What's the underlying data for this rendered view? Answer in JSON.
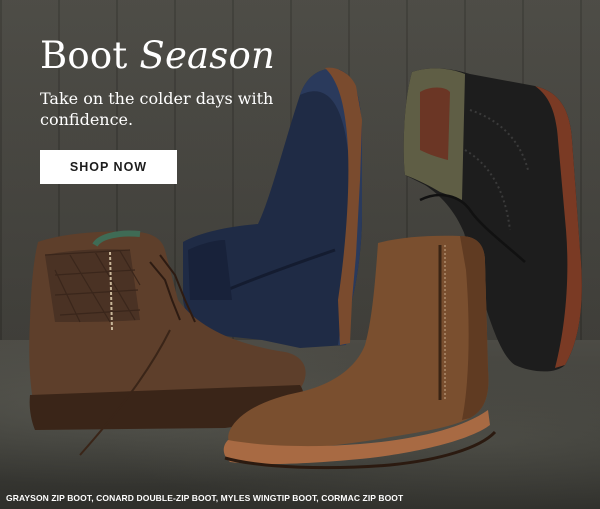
{
  "hero": {
    "title_main": "Boot",
    "title_italic": "Season",
    "subtitle": "Take on the colder days with confidence.",
    "cta_label": "SHOP NOW",
    "caption": "GRAYSON ZIP BOOT, CONARD DOUBLE-ZIP BOOT, MYLES WINGTIP BOOT, CORMAC ZIP BOOT"
  },
  "colors": {
    "background": "#3b3a35",
    "text": "#ffffff",
    "button_bg": "#ffffff",
    "button_text": "#1c1c1c"
  },
  "products": [
    {
      "name": "grayson-zip-boot",
      "color": "#6b4a33"
    },
    {
      "name": "conard-double-zip-boot",
      "color": "#1f2b45"
    },
    {
      "name": "myles-wingtip-boot",
      "color": "#1d1d1d"
    },
    {
      "name": "cormac-zip-boot",
      "color": "#7a4f2f"
    }
  ]
}
